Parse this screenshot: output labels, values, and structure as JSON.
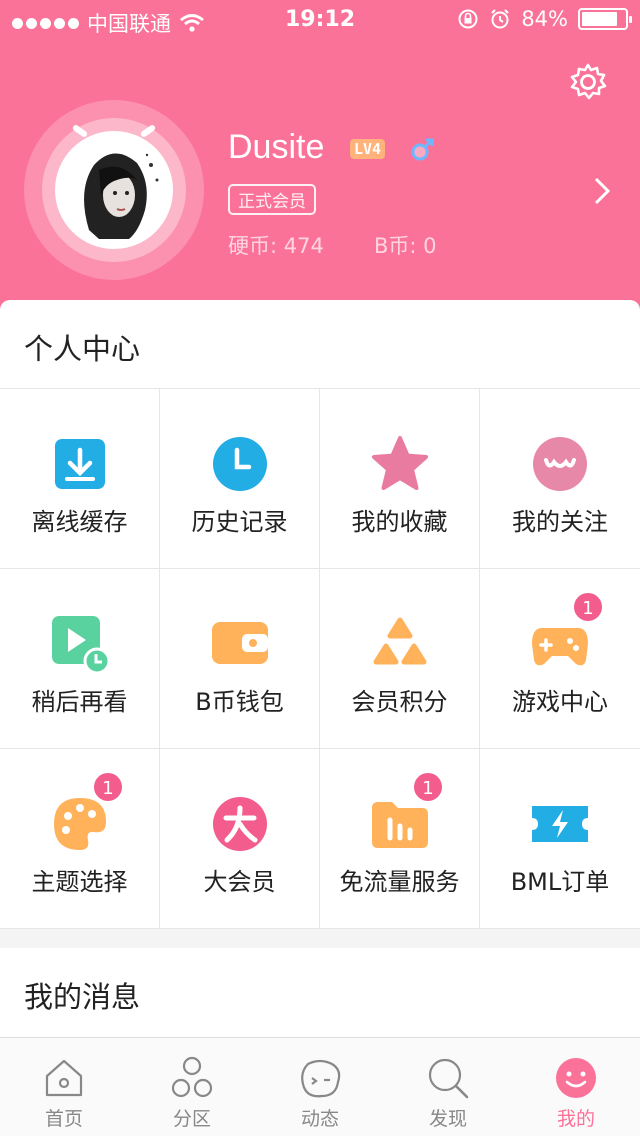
{
  "status_bar": {
    "carrier": "中国联通",
    "time": "19:12",
    "battery": "84%",
    "battery_level": 0.84
  },
  "profile": {
    "username": "Dusite",
    "level": "LV4",
    "member_tag": "正式会员",
    "coins": "硬币: 474",
    "b_coins": "B币: 0"
  },
  "personal_center": {
    "title": "个人中心",
    "items": [
      {
        "label": "离线缓存",
        "icon": "download-icon"
      },
      {
        "label": "历史记录",
        "icon": "clock-icon"
      },
      {
        "label": "我的收藏",
        "icon": "star-icon"
      },
      {
        "label": "我的关注",
        "icon": "follow-icon"
      },
      {
        "label": "稍后再看",
        "icon": "watch-later-icon"
      },
      {
        "label": "B币钱包",
        "icon": "wallet-icon"
      },
      {
        "label": "会员积分",
        "icon": "points-icon"
      },
      {
        "label": "游戏中心",
        "icon": "gamepad-icon",
        "badge": "1"
      },
      {
        "label": "主题选择",
        "icon": "palette-icon",
        "badge": "1"
      },
      {
        "label": "大会员",
        "icon": "vip-icon"
      },
      {
        "label": "免流量服务",
        "icon": "data-free-icon",
        "badge": "1"
      },
      {
        "label": "BML订单",
        "icon": "ticket-icon"
      }
    ]
  },
  "messages": {
    "title": "我的消息"
  },
  "tabbar": [
    {
      "label": "首页",
      "icon": "home-icon"
    },
    {
      "label": "分区",
      "icon": "category-icon"
    },
    {
      "label": "动态",
      "icon": "dynamic-icon"
    },
    {
      "label": "发现",
      "icon": "search-icon"
    },
    {
      "label": "我的",
      "icon": "profile-icon",
      "active": true
    }
  ],
  "colors": {
    "brand_pink": "#fb7299",
    "badge": "#f25d8e",
    "blue": "#23ade5",
    "green": "#5ad2a0",
    "orange": "#ffb25a"
  }
}
